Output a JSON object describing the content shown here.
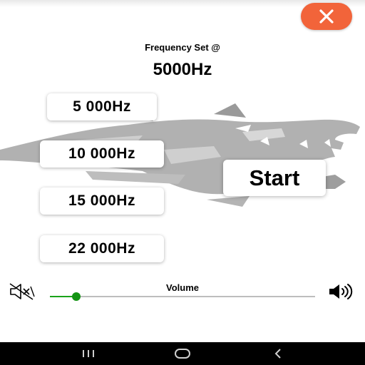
{
  "header": {
    "frequency_caption": "Frequency Set @",
    "current_frequency": "5000Hz"
  },
  "frequency_buttons": [
    {
      "label": "5 000Hz"
    },
    {
      "label": "10 000Hz"
    },
    {
      "label": "15 000Hz"
    },
    {
      "label": "22 000Hz"
    }
  ],
  "start_label": "Start",
  "volume": {
    "label": "Volume",
    "level_fraction": 0.1,
    "min_icon": "speaker-muted-icon",
    "max_icon": "speaker-loud-icon"
  },
  "icons": {
    "close": "close-icon",
    "background": "wolf-head-graphic"
  },
  "navigation_bar": {
    "recents_icon": "recents-icon",
    "home_icon": "home-icon",
    "back_icon": "back-icon"
  },
  "colors": {
    "close_button": "#f2643a",
    "slider_accent": "#139313",
    "navbar": "#000000"
  }
}
